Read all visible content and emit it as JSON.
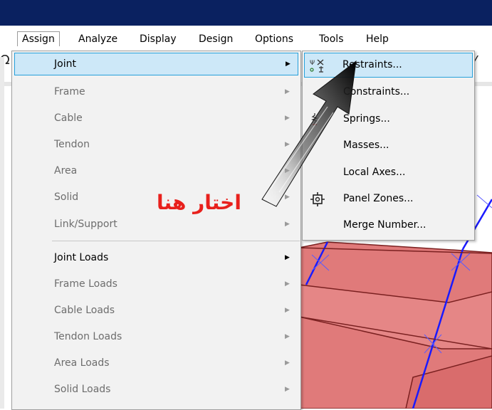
{
  "menubar": {
    "items": [
      "Assign",
      "Analyze",
      "Display",
      "Design",
      "Options",
      "Tools",
      "Help"
    ],
    "active": "Assign"
  },
  "assign_menu": {
    "items": [
      {
        "label": "Joint",
        "enabled": true,
        "submenu": true,
        "highlighted": true
      },
      {
        "label": "Frame",
        "enabled": false,
        "submenu": true
      },
      {
        "label": "Cable",
        "enabled": false,
        "submenu": true
      },
      {
        "label": "Tendon",
        "enabled": false,
        "submenu": true
      },
      {
        "label": "Area",
        "enabled": false,
        "submenu": true
      },
      {
        "label": "Solid",
        "enabled": false,
        "submenu": true
      },
      {
        "label": "Link/Support",
        "enabled": false,
        "submenu": true
      },
      {
        "label": "Joint Loads",
        "enabled": true,
        "submenu": true
      },
      {
        "label": "Frame Loads",
        "enabled": false,
        "submenu": true
      },
      {
        "label": "Cable Loads",
        "enabled": false,
        "submenu": true
      },
      {
        "label": "Tendon Loads",
        "enabled": false,
        "submenu": true
      },
      {
        "label": "Area Loads",
        "enabled": false,
        "submenu": true
      },
      {
        "label": "Solid Loads",
        "enabled": false,
        "submenu": true
      }
    ]
  },
  "joint_submenu": {
    "items": [
      {
        "label": "Restraints...",
        "icon": "restraints-icon",
        "highlighted": true
      },
      {
        "label": "Constraints...",
        "icon": ""
      },
      {
        "label": "Springs...",
        "icon": "springs-icon"
      },
      {
        "label": "Masses...",
        "icon": ""
      },
      {
        "label": "Local Axes...",
        "icon": ""
      },
      {
        "label": "Panel Zones...",
        "icon": "panel-zones-icon"
      },
      {
        "label": "Merge Number...",
        "icon": ""
      }
    ]
  },
  "annotation": {
    "text": "اختار هنا",
    "color": "#e8201c"
  },
  "colors": {
    "highlight_bg": "#cde8f8",
    "highlight_border": "#26a0da",
    "title_bar": "#0a2160",
    "model_fill": "#e07a7a",
    "frame_line": "#1a1aff"
  }
}
